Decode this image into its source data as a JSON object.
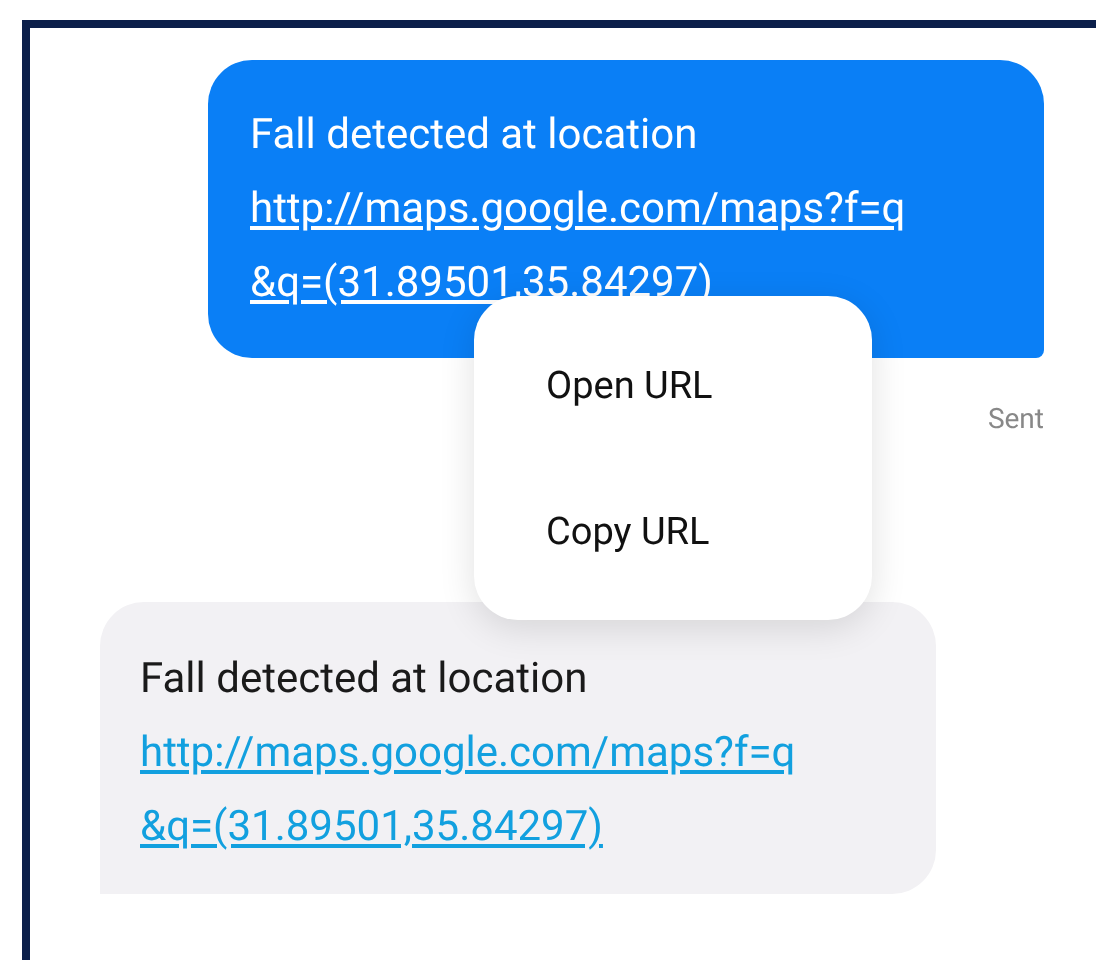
{
  "messages": [
    {
      "kind": "sent",
      "text": "Fall detected at location",
      "link": "http://maps.google.com/maps?f=q&q=(31.89501,35.84297)",
      "status": "Sent"
    },
    {
      "kind": "received",
      "text": "Fall detected at location",
      "link": "http://maps.google.com/maps?f=q&q=(31.89501,35.84297)"
    }
  ],
  "context_menu": {
    "items": [
      {
        "label": "Open URL"
      },
      {
        "label": "Copy URL"
      }
    ]
  }
}
